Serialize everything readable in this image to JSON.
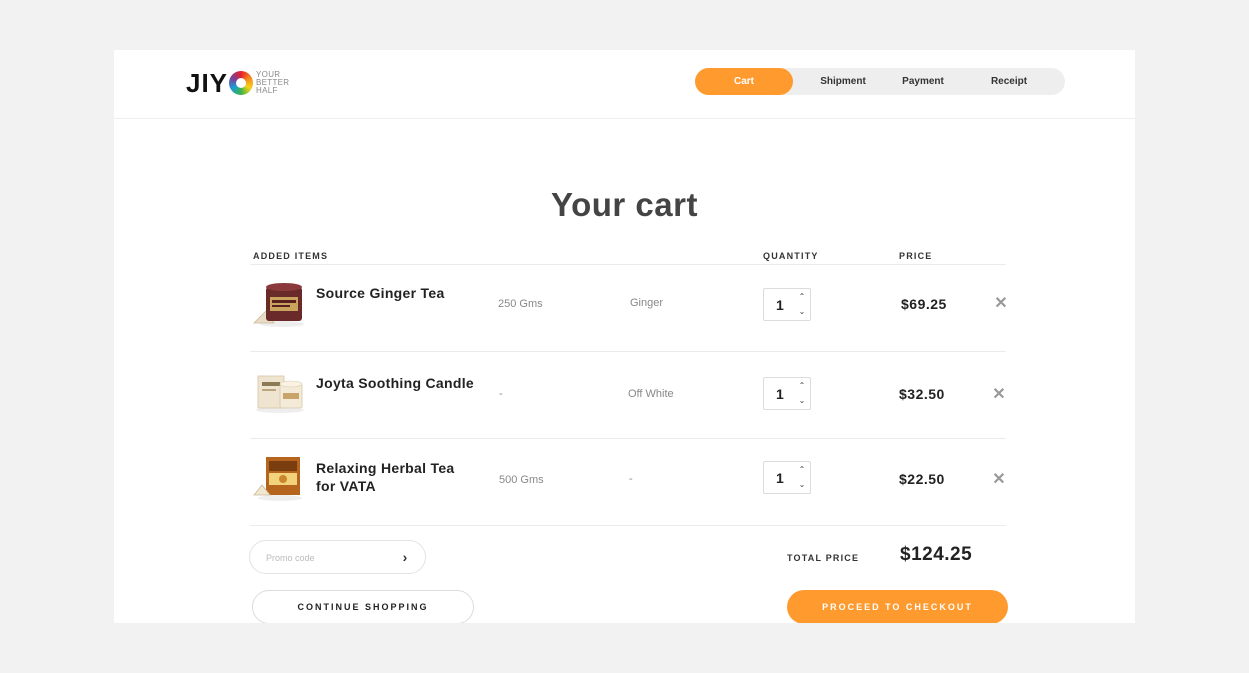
{
  "brand": {
    "logo_text": "JIY",
    "tagline_1": "YOUR",
    "tagline_2": "BETTER",
    "tagline_3": "HALF"
  },
  "steps": [
    {
      "label": "Cart",
      "active": true
    },
    {
      "label": "Shipment",
      "active": false
    },
    {
      "label": "Payment",
      "active": false
    },
    {
      "label": "Receipt",
      "active": false
    }
  ],
  "page_title": "Your cart",
  "columns": {
    "items": "ADDED ITEMS",
    "quantity": "QUANTITY",
    "price": "PRICE"
  },
  "items": [
    {
      "name": "Source Ginger Tea",
      "size": "250 Gms",
      "variant": "Ginger",
      "quantity": "1",
      "price": "$69.25",
      "thumb_icon": "ginger-tea-tin-icon"
    },
    {
      "name": "Joyta Soothing Candle",
      "size": "-",
      "variant": "Off White",
      "quantity": "1",
      "price": "$32.50",
      "thumb_icon": "candle-icon"
    },
    {
      "name": "Relaxing Herbal Tea for VATA",
      "size": "500 Gms",
      "variant": "-",
      "quantity": "1",
      "price": "$22.50",
      "thumb_icon": "herbal-tea-box-icon"
    }
  ],
  "promo": {
    "placeholder": "Promo code",
    "value": ""
  },
  "total": {
    "label": "TOTAL PRICE",
    "value": "$124.25"
  },
  "actions": {
    "continue_label": "CONTINUE SHOPPING",
    "checkout_label": "PROCEED TO CHECKOUT"
  },
  "colors": {
    "accent": "#ff9a2e",
    "background": "#f2f2f2",
    "card": "#ffffff"
  },
  "icons": {
    "qty_up": "chevron-up-icon",
    "qty_down": "chevron-down-icon",
    "remove": "close-icon",
    "promo_submit": "chevron-right-icon"
  }
}
